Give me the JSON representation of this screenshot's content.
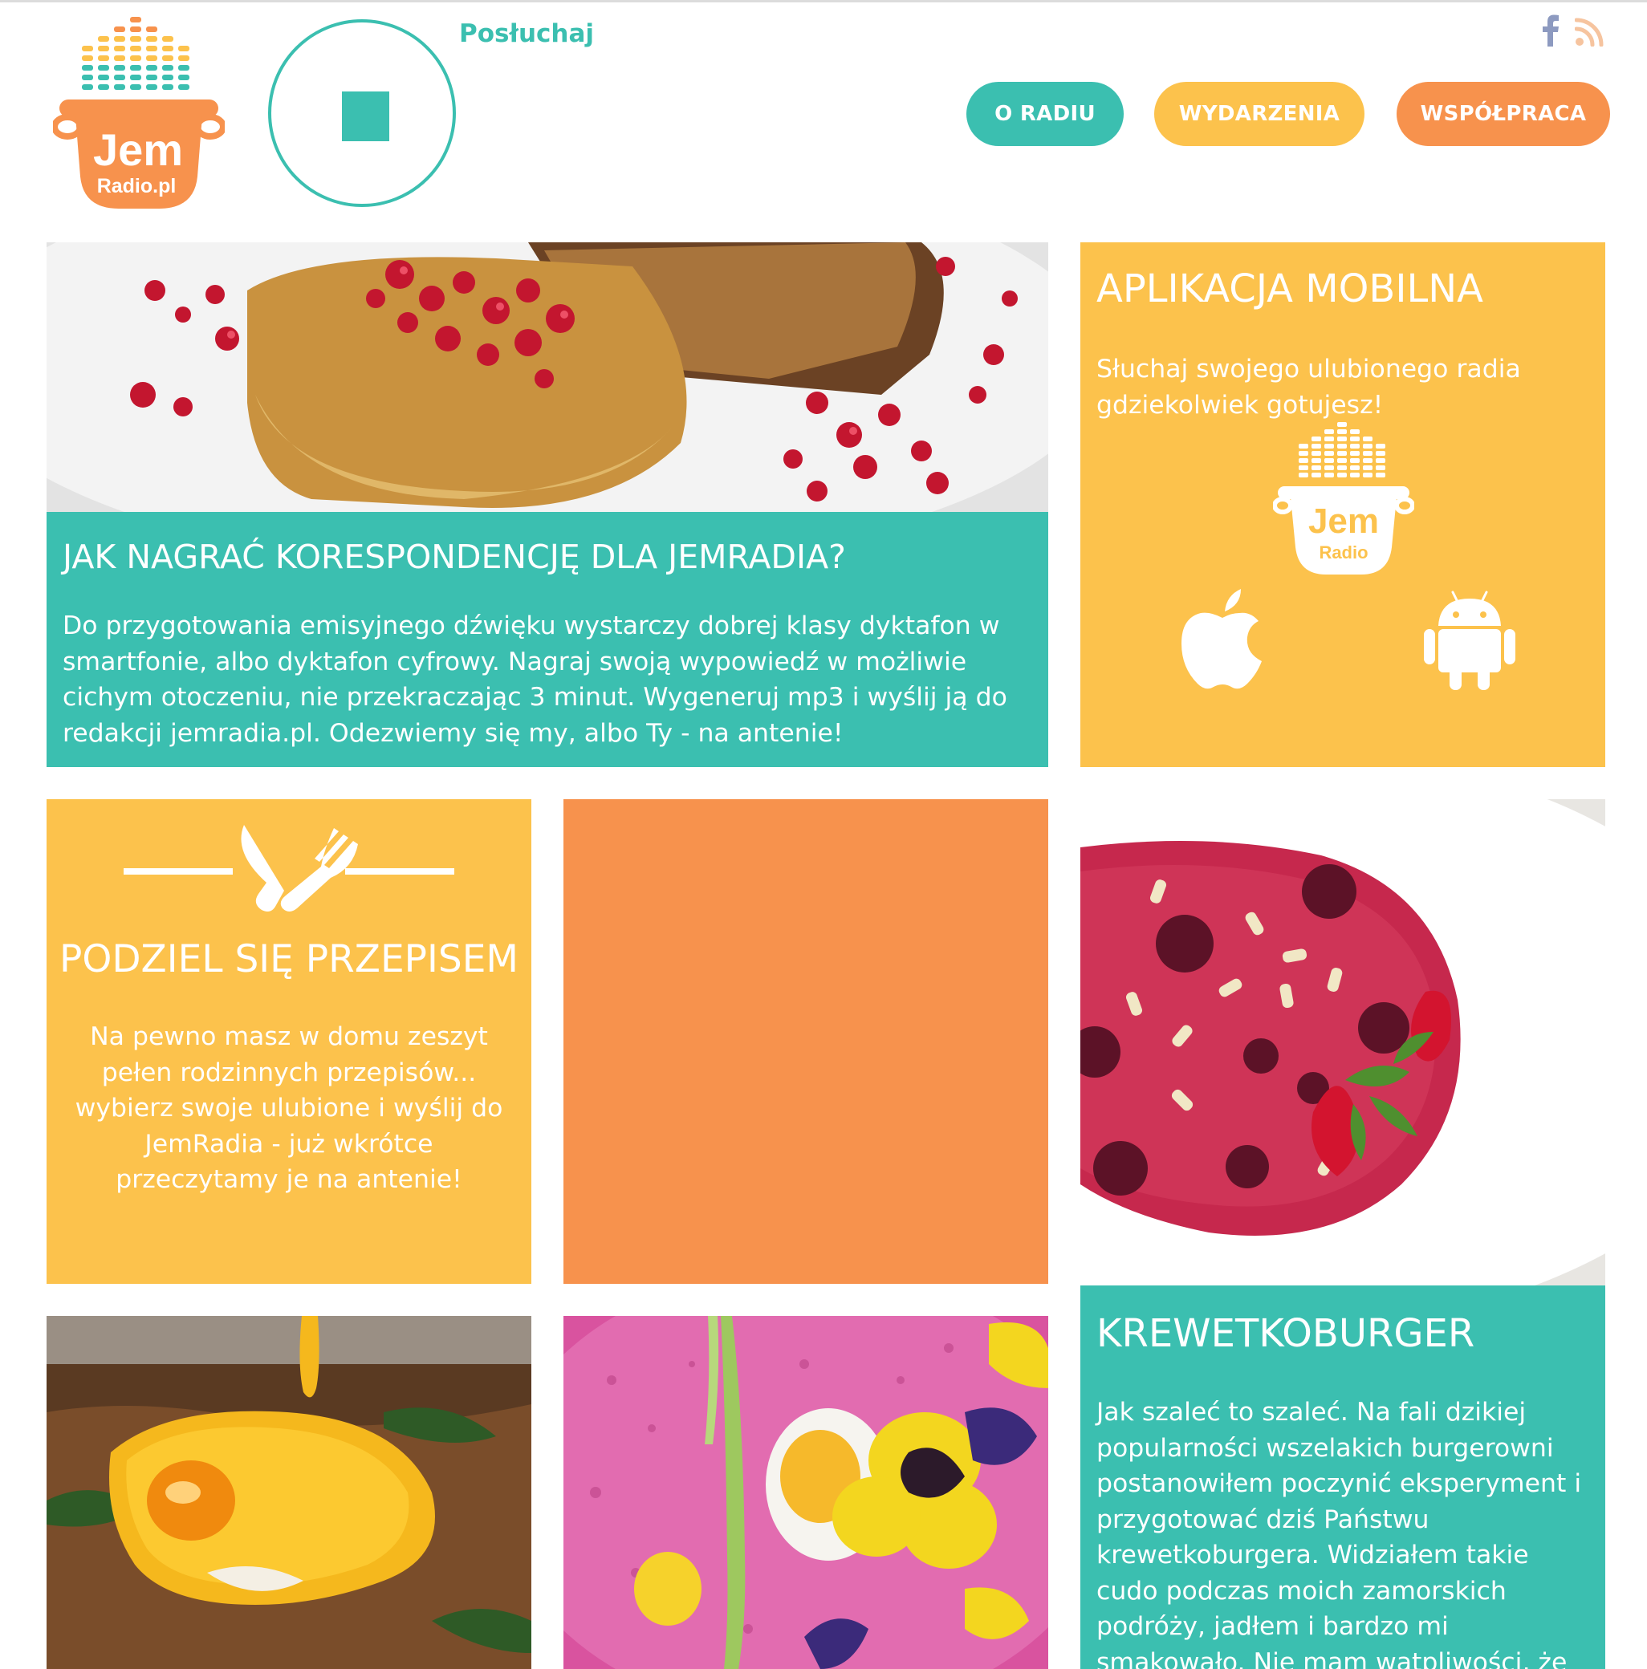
{
  "header": {
    "listen_label": "Posłuchaj",
    "logo_text_main": "Jem",
    "logo_text_sub": "Radio.pl",
    "social": [
      "facebook-icon",
      "rss-icon"
    ],
    "nav": [
      {
        "label": "O RADIU",
        "color": "#3bbfb0"
      },
      {
        "label": "WYDARZENIA",
        "color": "#fcc24c"
      },
      {
        "label": "WSPÓŁPRACA",
        "color": "#f7924d"
      }
    ]
  },
  "colors": {
    "teal": "#3bbfb0",
    "yellow": "#fcc24c",
    "orange": "#f7924d"
  },
  "tiles": {
    "correspondence": {
      "title": "JAK NAGRAĆ KORESPONDENCJĘ DLA JEMRADIA?",
      "body": "Do przygotowania emisyjnego dźwięku wystarczy dobrej klasy dyktafon w smartfonie, albo dyktafon cyfrowy. Nagraj swoją wypowiedź w możliwie cichym otoczeniu, nie przekraczając 3 minut. Wygeneruj mp3 i wyślij ją do redakcji jemradia.pl. Odezwiemy się my, albo Ty - na antenie!",
      "image": "french-toast-pomegranate-photo"
    },
    "mobile_app": {
      "title": "APLIKACJA MOBILNA",
      "body": "Słuchaj swojego ulubionego radia gdziekolwiek gotujesz!",
      "logo_text_main": "Jem",
      "logo_text_sub": "Radio",
      "stores": [
        "apple-icon",
        "android-icon"
      ]
    },
    "recipe": {
      "title": "PODZIEL SIĘ PRZEPISEM",
      "body": "Na pewno masz w domu zeszyt pełen rodzinnych przepisów... wybierz swoje ulubione i wyślij do JemRadia - już wkrótce przeczytamy je na antenie!"
    },
    "krewetkoburger": {
      "title": "KREWETKOBURGER",
      "body": "Jak szaleć to szaleć. Na fali dzikiej popularności wszelakich burgerowni postanowiłem poczynić eksperyment i przygotować dziś Państwu krewetkoburgera. Widziałem takie cudo podczas moich zamorskich podróży, jadłem i bardzo mi smakowało. Nie mam wątpliwości, że krowy w bułkach",
      "image": "berry-soup-photo"
    },
    "egg_photo": {
      "image": "poached-egg-hollandaise-photo"
    },
    "beet_soup_photo": {
      "image": "cold-beet-soup-photo"
    }
  }
}
